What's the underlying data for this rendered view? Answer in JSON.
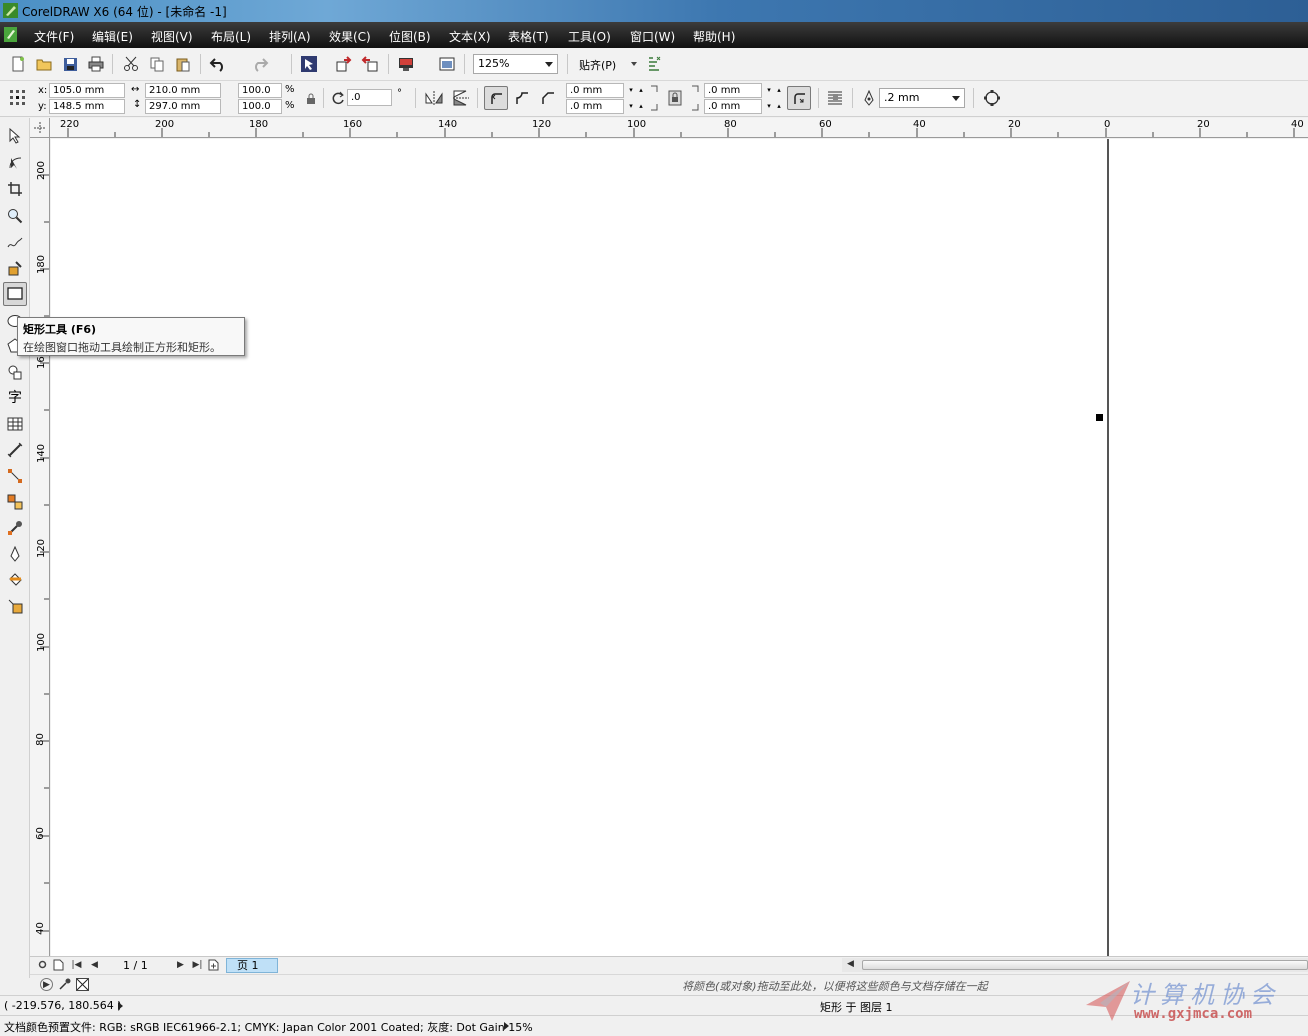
{
  "window": {
    "title": "CorelDRAW X6 (64 位) - [未命名 -1]"
  },
  "menu": [
    {
      "label": "文件(F)"
    },
    {
      "label": "编辑(E)"
    },
    {
      "label": "视图(V)"
    },
    {
      "label": "布局(L)"
    },
    {
      "label": "排列(A)"
    },
    {
      "label": "效果(C)"
    },
    {
      "label": "位图(B)"
    },
    {
      "label": "文本(X)"
    },
    {
      "label": "表格(T)"
    },
    {
      "label": "工具(O)"
    },
    {
      "label": "窗口(W)"
    },
    {
      "label": "帮助(H)"
    }
  ],
  "toolbar": {
    "zoom": "125%",
    "snap": "贴齐(P)"
  },
  "property_bar": {
    "x_label": "x:",
    "x": "105.0 mm",
    "y_label": "y:",
    "y": "148.5 mm",
    "width": "210.0 mm",
    "height": "297.0 mm",
    "scale_x": "100.0",
    "scale_y": "100.0",
    "percent": "%",
    "rotation": ".0",
    "degree": "°",
    "corner_1": ".0 mm",
    "corner_2": ".0 mm",
    "corner_3": ".0 mm",
    "corner_4": ".0 mm",
    "outline_width": ".2 mm"
  },
  "rulers": {
    "h_ticks": [
      "220",
      "200",
      "180",
      "160",
      "140",
      "120",
      "100",
      "80",
      "60",
      "40",
      "20",
      "0",
      "20",
      "40"
    ],
    "v_ticks": [
      "200",
      "180",
      "160",
      "140",
      "120",
      "100",
      "80",
      "60",
      "40"
    ]
  },
  "tooltip": {
    "title": "矩形工具 (F6)",
    "description": "在绘图窗口拖动工具绘制正方形和矩形。"
  },
  "page_nav": {
    "page_count": "1 / 1",
    "page_tab": "页 1"
  },
  "palette_hint": "将颜色(或对象)拖动至此处，以便将这些颜色与文档存储在一起",
  "status": {
    "coordinates": "( -219.576, 180.564 )",
    "selection_info": "矩形 于 图层 1",
    "color_profile": "文档颜色预置文件: RGB: sRGB IEC61966-2.1; CMYK: Japan Color 2001 Coated; 灰度: Dot Gain 15%"
  },
  "watermark": {
    "title": "计算机协会",
    "url": "www.gxjmca.com"
  },
  "colors": {
    "menubar_bg": "#1e1e1e",
    "page_tab": "#bfe0f7",
    "tooltip_border": "#7a7a7a"
  }
}
